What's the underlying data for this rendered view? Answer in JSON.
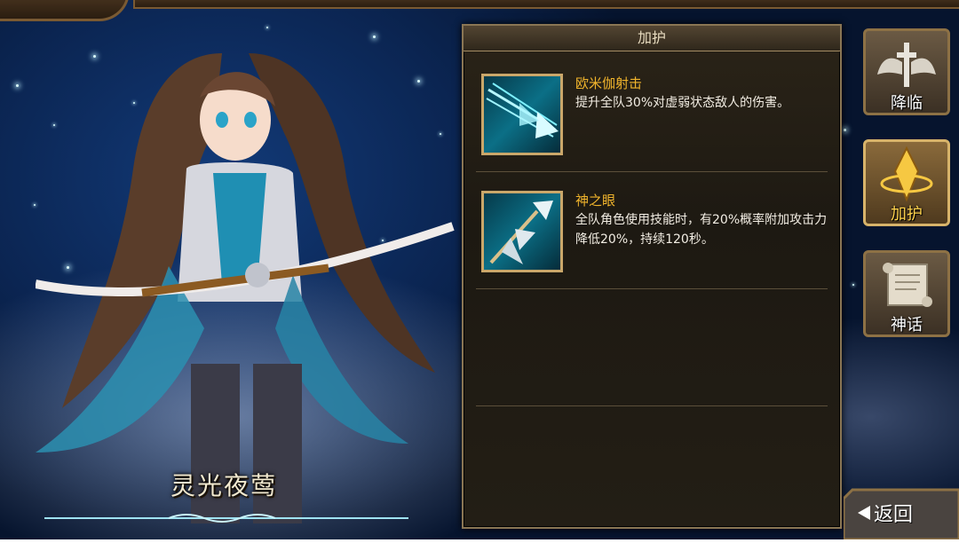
{
  "character": {
    "name": "灵光夜莺"
  },
  "panel": {
    "title": "加护",
    "skills": [
      {
        "name": "欧米伽射击",
        "desc": "提升全队30%对虚弱状态敌人的伤害。",
        "icon": "arrow-burst-icon"
      },
      {
        "name": "神之眼",
        "desc": "全队角色使用技能时，有20%概率附加攻击力降低20%，持续120秒。",
        "icon": "arrow-heads-icon"
      }
    ]
  },
  "sidebar": {
    "tabs": [
      {
        "label": "降临",
        "icon": "winged-cross-icon",
        "active": false
      },
      {
        "label": "加护",
        "icon": "golden-crest-icon",
        "active": true
      },
      {
        "label": "神话",
        "icon": "scroll-icon",
        "active": false
      }
    ]
  },
  "back": {
    "label": "返回"
  },
  "colors": {
    "skill_name": "#f0b42c",
    "active_tab_label": "#ffd34d",
    "panel_border": "#8a7654"
  }
}
